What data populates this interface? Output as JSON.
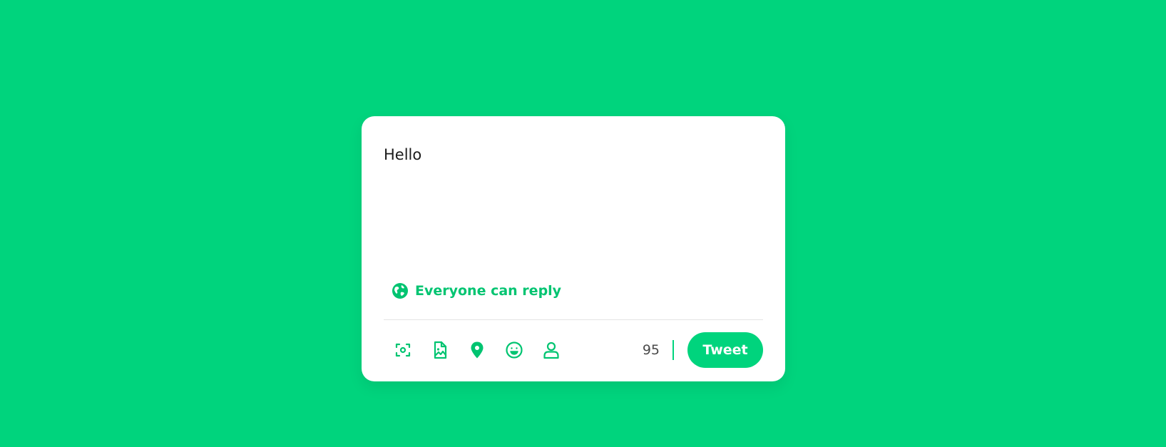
{
  "compose": {
    "value": "Hello"
  },
  "reply_setting": {
    "label": "Everyone can reply",
    "icon": "globe-icon"
  },
  "toolbar": {
    "tools": [
      {
        "icon": "camera-icon"
      },
      {
        "icon": "image-file-icon"
      },
      {
        "icon": "location-pin-icon"
      },
      {
        "icon": "emoji-icon"
      },
      {
        "icon": "user-icon"
      }
    ],
    "char_count": "95",
    "tweet_label": "Tweet"
  },
  "colors": {
    "background": "#00d47d",
    "accent": "#00c471",
    "card": "#ffffff"
  }
}
